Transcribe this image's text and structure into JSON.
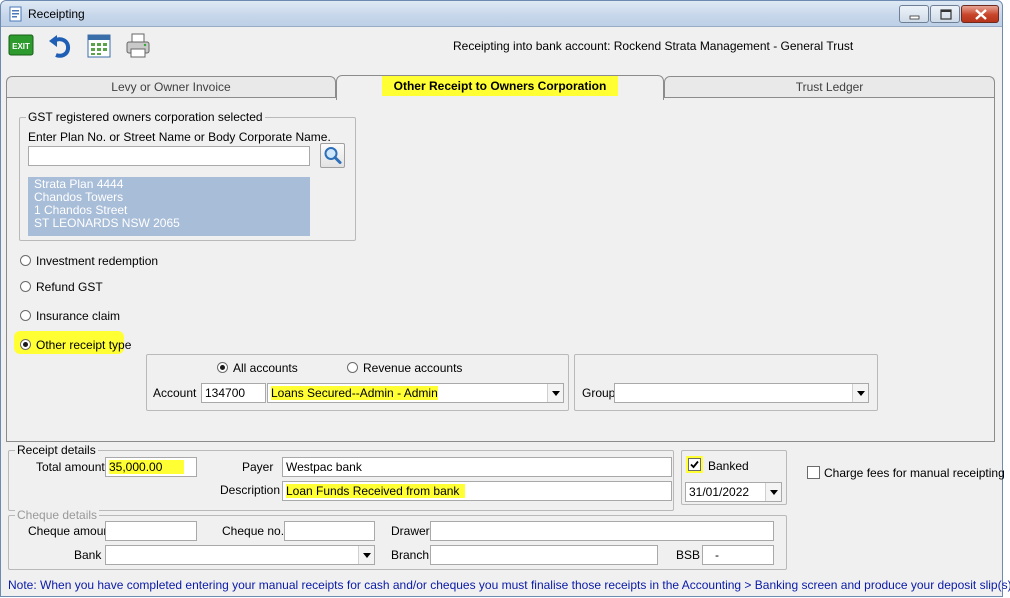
{
  "window": {
    "title": "Receipting"
  },
  "toolbar": {
    "exit_label": "EXIT",
    "bank_account_text": "Receipting into bank account: Rockend Strata Management - General Trust"
  },
  "tabs": [
    {
      "label": "Levy or Owner Invoice"
    },
    {
      "label": "Other Receipt to Owners Corporation"
    },
    {
      "label": "Trust Ledger"
    }
  ],
  "gst_group": {
    "legend": "GST registered owners corporation selected",
    "search_label": "Enter Plan No. or Street Name or Body Corporate Name.",
    "search_value": "",
    "address_lines": [
      "Strata Plan 4444",
      "Chandos Towers",
      "1 Chandos Street",
      "ST LEONARDS  NSW  2065"
    ]
  },
  "receipt_types": [
    {
      "label": "Investment redemption"
    },
    {
      "label": "Refund GST"
    },
    {
      "label": "Insurance claim"
    },
    {
      "label": "Other receipt type"
    }
  ],
  "account_group": {
    "all_accounts_label": "All accounts",
    "revenue_accounts_label": "Revenue accounts",
    "account_label": "Account",
    "account_code": "134700",
    "account_name": "Loans Secured--Admin - Admin",
    "group_label": "Group",
    "group_value": ""
  },
  "receipt_details": {
    "legend": "Receipt details",
    "total_amount_label": "Total amount",
    "total_amount": "35,000.00",
    "payer_label": "Payer",
    "payer": "Westpac bank",
    "description_label": "Description",
    "description": "Loan Funds Received from bank",
    "banked_label": "Banked",
    "banked_date": "31/01/2022",
    "charge_fees_label": "Charge fees for manual receipting"
  },
  "cheque_details": {
    "legend": "Cheque details",
    "cheque_amount_label": "Cheque amount",
    "cheque_no_label": "Cheque no.",
    "drawer_label": "Drawer",
    "bank_label": "Bank",
    "branch_label": "Branch",
    "bsb_label": "BSB",
    "bsb_value": "-"
  },
  "note": "Note: When you have completed entering your manual receipts for cash and/or cheques you must finalise those receipts in the Accounting > Banking screen and produce your deposit slip(s)."
}
